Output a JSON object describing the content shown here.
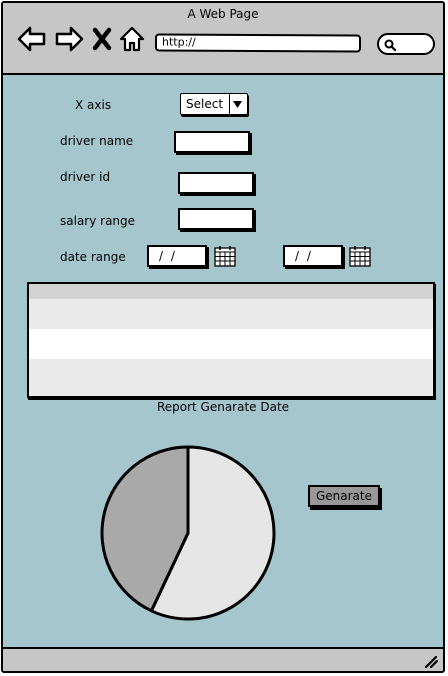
{
  "window": {
    "title": "A Web Page"
  },
  "browser": {
    "url": "http://",
    "icons": [
      "back-arrow-icon",
      "forward-arrow-icon",
      "close-x-icon",
      "home-icon",
      "search-icon"
    ]
  },
  "form": {
    "x_axis_label": "X axis",
    "x_axis_select": "Select",
    "driver_name_label": "driver name",
    "driver_id_label": "driver id",
    "salary_range_label": "salary range",
    "date_range_label": "date range",
    "date_from": "/ /",
    "date_to": "/ /"
  },
  "report": {
    "caption": "Report Genarate Date"
  },
  "chart": {
    "type": "pie",
    "slices": [
      {
        "value": 57,
        "color": "#e6e6e6"
      },
      {
        "value": 43,
        "color": "#a9a9a9"
      }
    ]
  },
  "actions": {
    "generate_label": "Genarate"
  },
  "colors": {
    "body": "#a6c6cd",
    "chrome": "#c6c6c6",
    "button": "#989898"
  }
}
